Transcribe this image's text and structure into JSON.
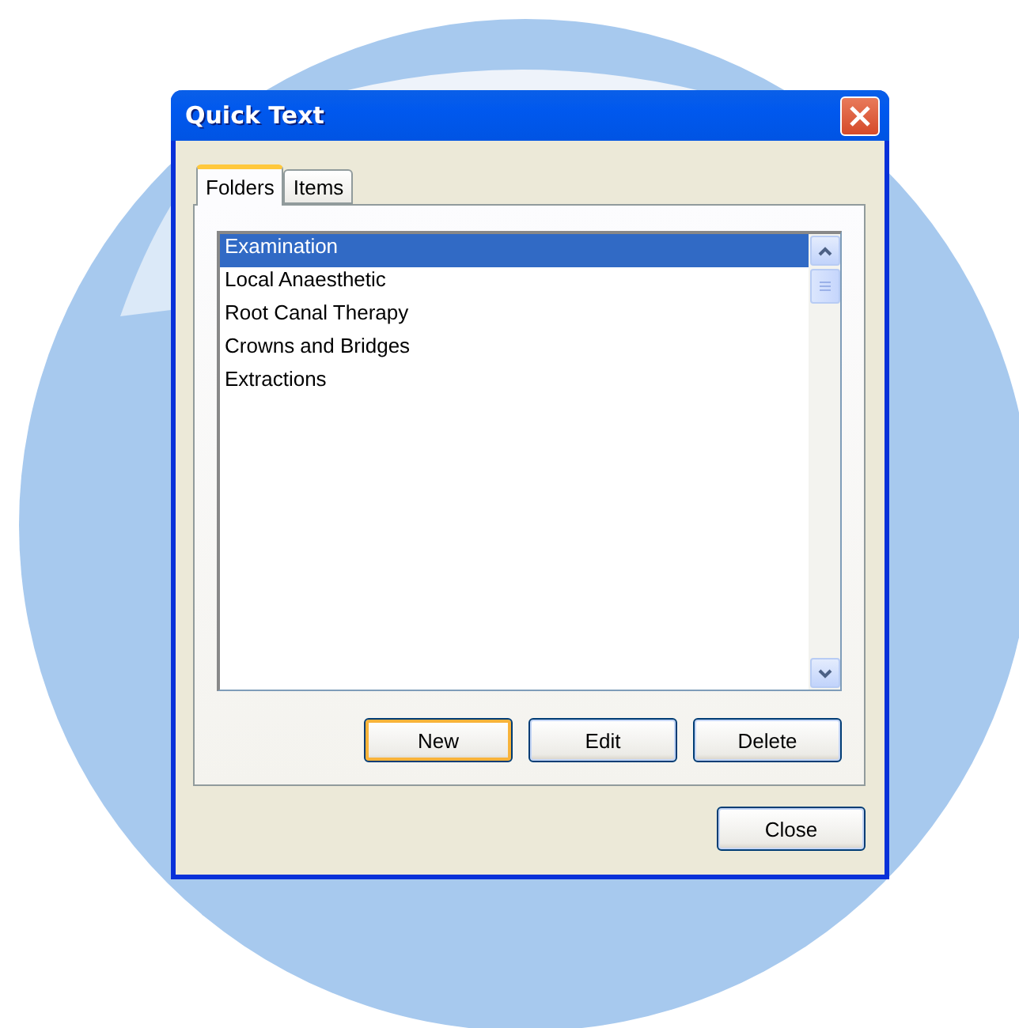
{
  "window": {
    "title": "Quick Text"
  },
  "tabs": [
    {
      "label": "Folders",
      "selected": true
    },
    {
      "label": "Items",
      "selected": false
    }
  ],
  "folders": [
    {
      "label": "Examination",
      "selected": true
    },
    {
      "label": "Local Anaesthetic",
      "selected": false
    },
    {
      "label": "Root Canal Therapy",
      "selected": false
    },
    {
      "label": "Crowns and Bridges",
      "selected": false
    },
    {
      "label": "Extractions",
      "selected": false
    }
  ],
  "panel_buttons": [
    {
      "label": "New",
      "focused": true
    },
    {
      "label": "Edit",
      "focused": false
    },
    {
      "label": "Delete",
      "focused": false
    }
  ],
  "footer_buttons": [
    {
      "label": "Close",
      "focused": false
    }
  ]
}
